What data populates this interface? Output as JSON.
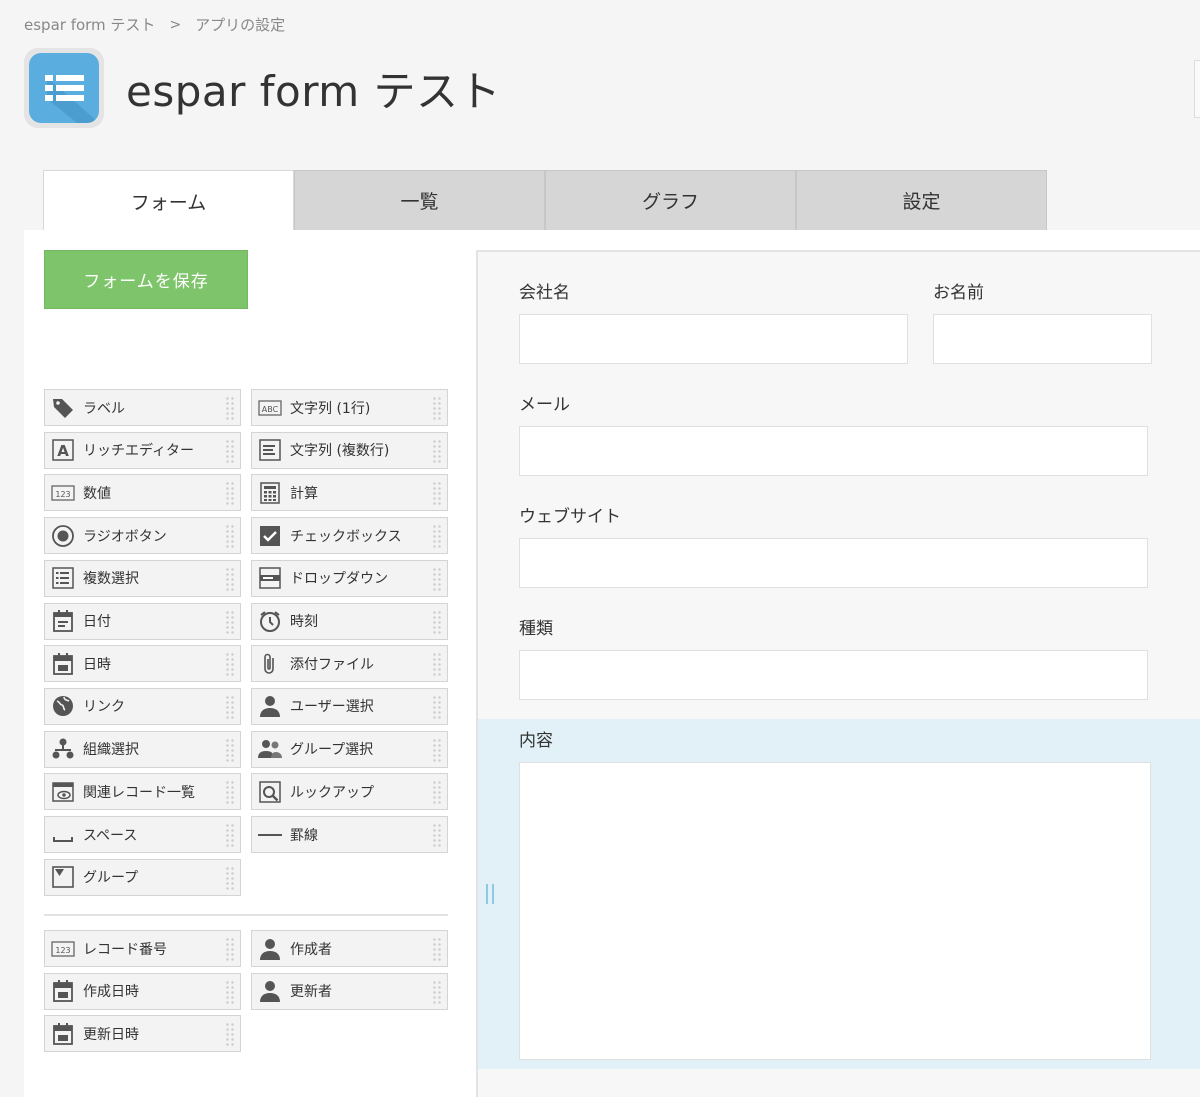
{
  "breadcrumb": {
    "app": "espar form テスト",
    "separator": ">",
    "current": "アプリの設定"
  },
  "header": {
    "title": "espar form テスト"
  },
  "tabs": [
    {
      "label": "フォーム",
      "active": true
    },
    {
      "label": "一覧",
      "active": false
    },
    {
      "label": "グラフ",
      "active": false
    },
    {
      "label": "設定",
      "active": false
    }
  ],
  "palette": {
    "save_label": "フォームを保存",
    "fields": [
      {
        "label": "ラベル",
        "icon": "tag-icon"
      },
      {
        "label": "文字列 (1行)",
        "icon": "abc-icon"
      },
      {
        "label": "リッチエディター",
        "icon": "rich-text-icon"
      },
      {
        "label": "文字列 (複数行)",
        "icon": "multiline-text-icon"
      },
      {
        "label": "数値",
        "icon": "number-icon"
      },
      {
        "label": "計算",
        "icon": "calculator-icon"
      },
      {
        "label": "ラジオボタン",
        "icon": "radio-icon"
      },
      {
        "label": "チェックボックス",
        "icon": "checkbox-icon"
      },
      {
        "label": "複数選択",
        "icon": "multi-select-icon"
      },
      {
        "label": "ドロップダウン",
        "icon": "dropdown-icon"
      },
      {
        "label": "日付",
        "icon": "date-icon"
      },
      {
        "label": "時刻",
        "icon": "clock-icon"
      },
      {
        "label": "日時",
        "icon": "datetime-icon"
      },
      {
        "label": "添付ファイル",
        "icon": "paperclip-icon"
      },
      {
        "label": "リンク",
        "icon": "globe-icon"
      },
      {
        "label": "ユーザー選択",
        "icon": "user-icon"
      },
      {
        "label": "組織選択",
        "icon": "org-icon"
      },
      {
        "label": "グループ選択",
        "icon": "group-icon"
      },
      {
        "label": "関連レコード一覧",
        "icon": "related-records-icon"
      },
      {
        "label": "ルックアップ",
        "icon": "lookup-icon"
      },
      {
        "label": "スペース",
        "icon": "space-icon"
      },
      {
        "label": "罫線",
        "icon": "line-icon"
      },
      {
        "label": "グループ",
        "icon": "group-box-icon"
      }
    ],
    "system_fields": [
      {
        "label": "レコード番号",
        "icon": "number-icon"
      },
      {
        "label": "作成者",
        "icon": "user-icon"
      },
      {
        "label": "作成日時",
        "icon": "datetime-icon"
      },
      {
        "label": "更新者",
        "icon": "user-icon"
      },
      {
        "label": "更新日時",
        "icon": "datetime-icon"
      }
    ]
  },
  "form": {
    "fields": [
      {
        "label": "会社名"
      },
      {
        "label": "お名前"
      },
      {
        "label": "メール"
      },
      {
        "label": "ウェブサイト"
      },
      {
        "label": "種類"
      },
      {
        "label": "内容"
      }
    ]
  },
  "colors": {
    "accent": "#7ec46a",
    "icon_bg": "#5aaedf",
    "highlight": "#e1f1f7"
  }
}
